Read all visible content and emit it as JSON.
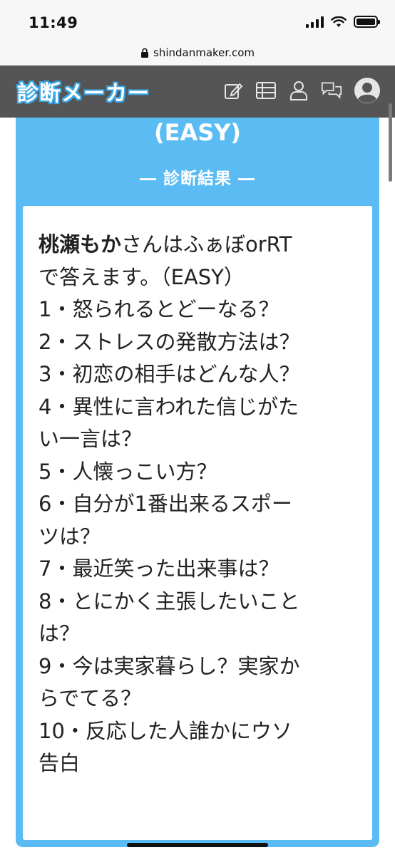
{
  "status_bar": {
    "time": "11:49"
  },
  "browser": {
    "url": "shindanmaker.com"
  },
  "header": {
    "logo": "診断メーカー",
    "icons": [
      "edit-icon",
      "list-icon",
      "user-icon",
      "chat-icon",
      "avatar-icon"
    ]
  },
  "card": {
    "title": "(EASY)",
    "subtitle": "― 診断結果 ―",
    "result": {
      "name": "桃瀬もか",
      "lines": [
        "さんはふぁぼorRT",
        "で答えます。（EASY）",
        "1・怒られるとどーなる？",
        "2・ストレスの発散方法は？",
        "3・初恋の相手はどんな人？",
        "4・異性に言われた信じがた",
        "い一言は？",
        "5・人懐っこい方？",
        "6・自分が1番出来るスポー",
        "ツは？",
        "7・最近笑った出来事は？",
        "8・とにかく主張したいこと",
        "は？",
        "9・今は実家暮らし？実家か",
        "らでてる？",
        "10・反応した人誰かにウソ",
        "告白"
      ]
    }
  },
  "colors": {
    "accent": "#5bbcf3",
    "header_bg": "#555555",
    "logo_outline": "#3aa6e8"
  }
}
